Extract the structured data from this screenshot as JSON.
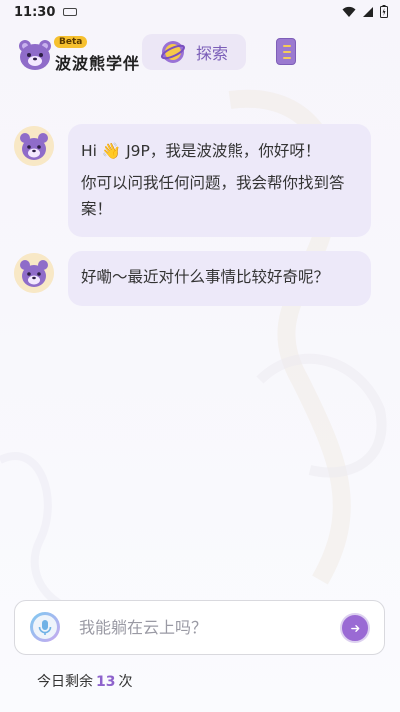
{
  "status_bar": {
    "time": "11:30"
  },
  "header": {
    "badge": "Beta",
    "app_title": "波波熊学伴",
    "explore_label": "探索"
  },
  "messages": [
    {
      "lines": [
        "Hi 👋 J9P，我是波波熊，你好呀！",
        "你可以问我任何问题，我会帮你找到答案！"
      ]
    },
    {
      "text": "好嘞～最近对什么事情比较好奇呢？"
    }
  ],
  "input": {
    "placeholder": "我能躺在云上吗？",
    "value": ""
  },
  "remaining": {
    "prefix": "今日剩余",
    "count": "13",
    "suffix": "次"
  },
  "colors": {
    "accent": "#9a6ad4",
    "bubble": "#ede9f9",
    "badge": "#f6c02f"
  },
  "icons": [
    "keyboard-icon",
    "wifi-icon",
    "signal-icon",
    "battery-icon",
    "bear-logo-icon",
    "planet-icon",
    "menu-icon",
    "bear-avatar-icon",
    "mic-icon",
    "send-arrow-icon"
  ]
}
